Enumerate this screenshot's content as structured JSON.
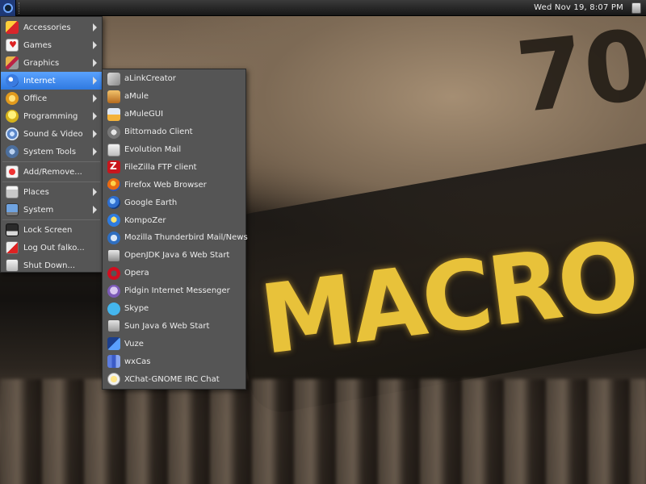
{
  "panel": {
    "clock": "Wed Nov 19,  8:07 PM"
  },
  "wallpaper": {
    "lens_text": "MACRO",
    "lens_number": "70"
  },
  "main_menu": {
    "items": [
      {
        "label": "Accessories",
        "icon": "accessories-icon",
        "submenu": true
      },
      {
        "label": "Games",
        "icon": "games-icon",
        "submenu": true
      },
      {
        "label": "Graphics",
        "icon": "graphics-icon",
        "submenu": true
      },
      {
        "label": "Internet",
        "icon": "internet-icon",
        "submenu": true,
        "active": true
      },
      {
        "label": "Office",
        "icon": "office-icon",
        "submenu": true
      },
      {
        "label": "Programming",
        "icon": "programming-icon",
        "submenu": true
      },
      {
        "label": "Sound & Video",
        "icon": "sound-video-icon",
        "submenu": true
      },
      {
        "label": "System Tools",
        "icon": "system-tools-icon",
        "submenu": true
      },
      {
        "label": "Add/Remove...",
        "icon": "add-remove-icon"
      },
      {
        "label": "Places",
        "icon": "places-icon",
        "submenu": true
      },
      {
        "label": "System",
        "icon": "system-icon",
        "submenu": true
      },
      {
        "label": "Lock Screen",
        "icon": "lock-screen-icon"
      },
      {
        "label": "Log Out falko...",
        "icon": "log-out-icon"
      },
      {
        "label": "Shut Down...",
        "icon": "shut-down-icon"
      }
    ]
  },
  "internet_menu": {
    "items": [
      {
        "label": "aLinkCreator",
        "icon": "alinkcreator-icon"
      },
      {
        "label": "aMule",
        "icon": "amule-icon"
      },
      {
        "label": "aMuleGUI",
        "icon": "amulegui-icon"
      },
      {
        "label": "Bittornado Client",
        "icon": "bittornado-icon"
      },
      {
        "label": "Evolution Mail",
        "icon": "evolution-mail-icon"
      },
      {
        "label": "FileZilla FTP client",
        "icon": "filezilla-icon"
      },
      {
        "label": "Firefox Web Browser",
        "icon": "firefox-icon"
      },
      {
        "label": "Google Earth",
        "icon": "google-earth-icon"
      },
      {
        "label": "KompoZer",
        "icon": "kompozer-icon"
      },
      {
        "label": "Mozilla Thunderbird Mail/News",
        "icon": "thunderbird-icon"
      },
      {
        "label": "OpenJDK Java 6 Web Start",
        "icon": "openjdk-icon"
      },
      {
        "label": "Opera",
        "icon": "opera-icon"
      },
      {
        "label": "Pidgin Internet Messenger",
        "icon": "pidgin-icon"
      },
      {
        "label": "Skype",
        "icon": "skype-icon"
      },
      {
        "label": "Sun Java 6 Web Start",
        "icon": "sun-java-icon"
      },
      {
        "label": "Vuze",
        "icon": "vuze-icon"
      },
      {
        "label": "wxCas",
        "icon": "wxcas-icon"
      },
      {
        "label": "XChat-GNOME IRC Chat",
        "icon": "xchat-icon"
      }
    ]
  },
  "colors": {
    "menu_bg": "#555555",
    "highlight": "#3a86f0",
    "panel_bg": "#1e1e1e",
    "wallpaper_text": "#e8c23a"
  }
}
